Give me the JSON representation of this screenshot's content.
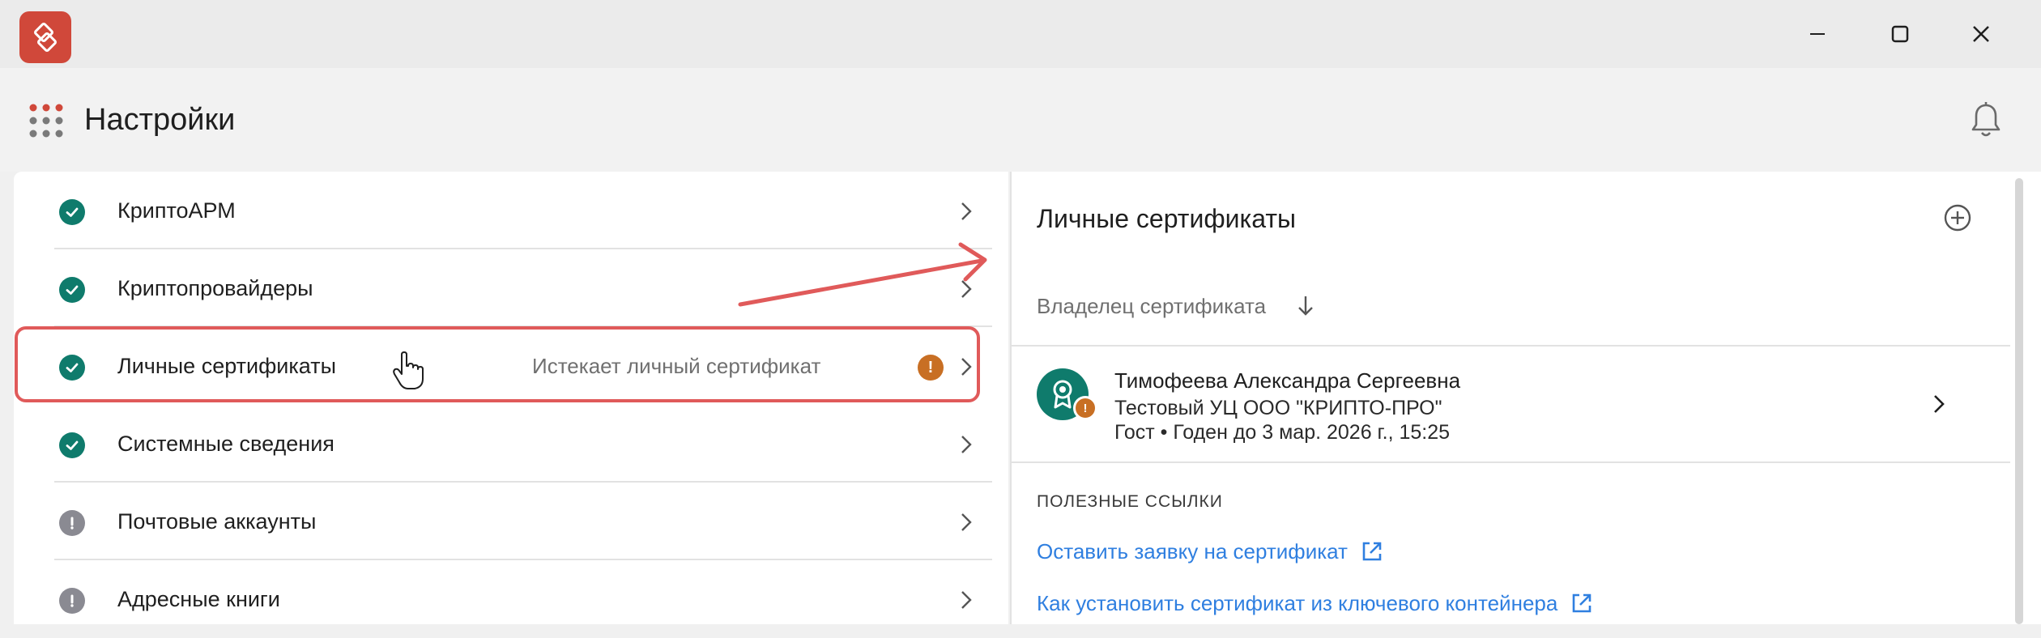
{
  "window": {
    "logo_icon": "cryptoarm-logo-icon",
    "controls": [
      "minimize-icon",
      "maximize-icon",
      "close-icon"
    ]
  },
  "header": {
    "title": "Настройки",
    "menu_icon": "apps-grid-icon",
    "bell_icon": "bell-icon"
  },
  "sidebar": {
    "items": [
      {
        "label": "КриптоАРМ",
        "status": "ok"
      },
      {
        "label": "Криптопровайдеры",
        "status": "ok"
      },
      {
        "label": "Личные сертификаты",
        "status": "ok",
        "note": "Истекает личный сертификат",
        "warning": "!"
      },
      {
        "label": "Системные сведения",
        "status": "ok"
      },
      {
        "label": "Почтовые аккаунты",
        "status": "warning"
      },
      {
        "label": "Адресные книги",
        "status": "warning"
      }
    ]
  },
  "detail": {
    "title": "Личные сертификаты",
    "add_icon": "plus-circle-icon",
    "sort_label": "Владелец сертификата",
    "certificate": {
      "owner": "Тимофеева Александра Сергеевна",
      "issuer": "Тестовый УЦ ООО \"КРИПТО-ПРО\"",
      "validity": "Гост • Годен до 3 мар. 2026 г., 15:25",
      "badge": "!"
    },
    "links_heading": "ПОЛЕЗНЫЕ ССЫЛКИ",
    "links": [
      "Оставить заявку на сертификат",
      "Как установить сертификат из ключевого контейнера"
    ]
  },
  "colors": {
    "accent_teal": "#0f7b6c",
    "warning_orange": "#c86f24",
    "highlight_red": "#e05a5a",
    "link_blue": "#2f7fe0",
    "logo_red": "#d0483a"
  }
}
